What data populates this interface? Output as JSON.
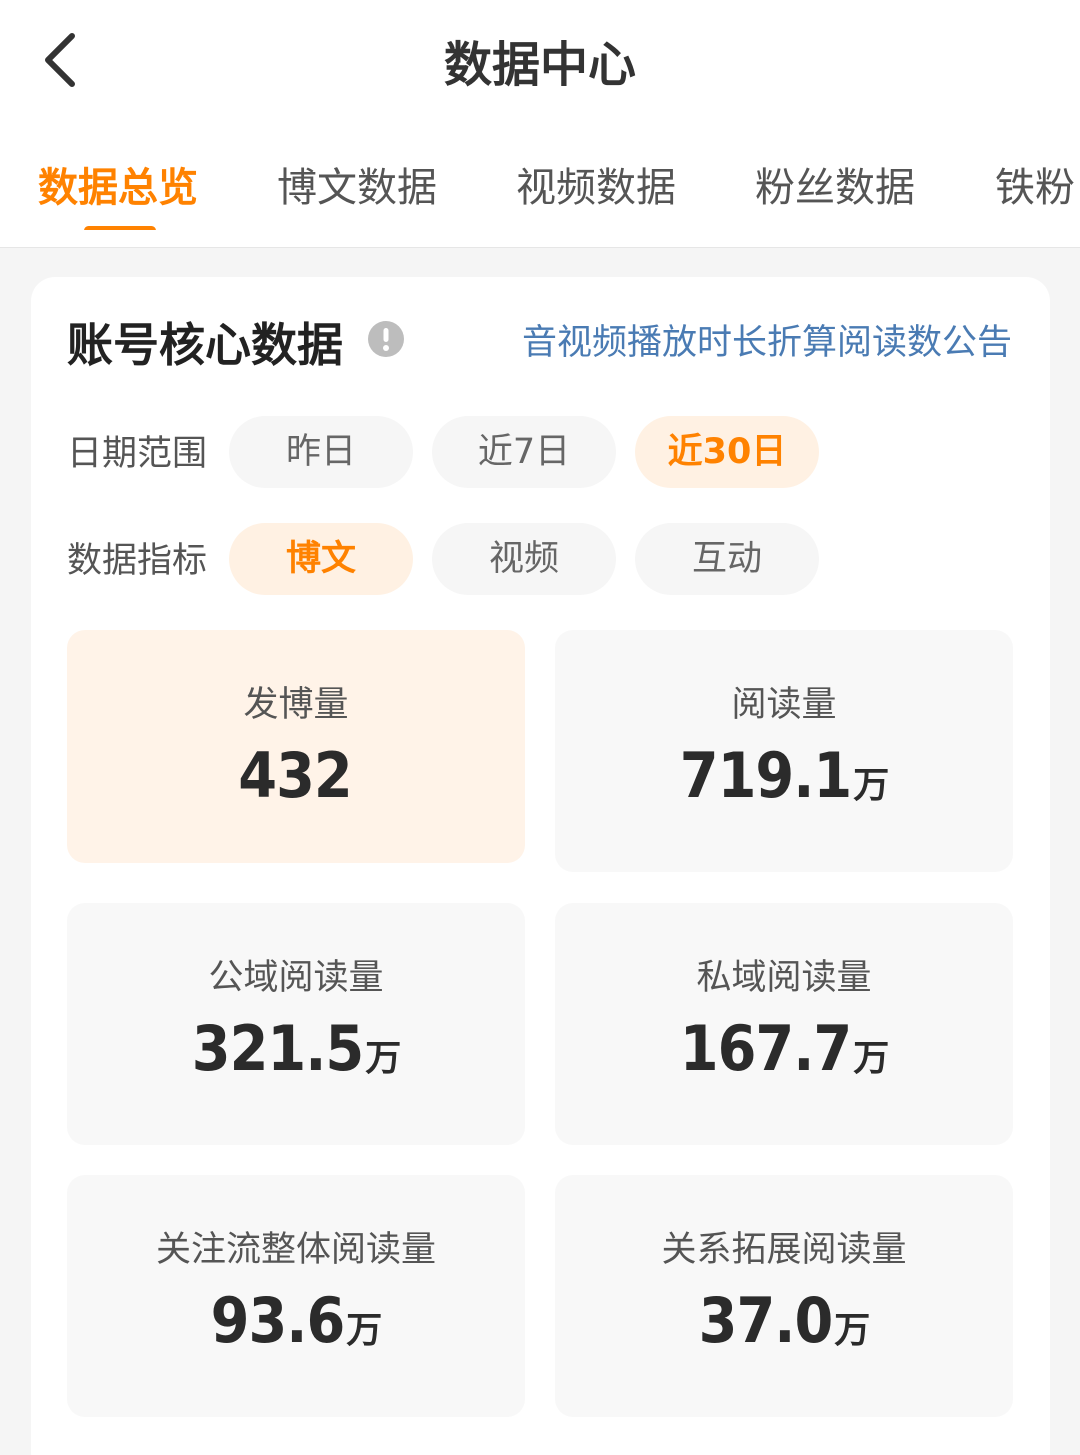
{
  "header": {
    "title": "数据中心",
    "back_icon": "chevron-left-icon"
  },
  "tabs": [
    {
      "label": "数据总览",
      "active": true
    },
    {
      "label": "博文数据",
      "active": false
    },
    {
      "label": "视频数据",
      "active": false
    },
    {
      "label": "粉丝数据",
      "active": false
    },
    {
      "label": "铁粉",
      "active": false
    }
  ],
  "core": {
    "title": "账号核心数据",
    "info_icon": "info-icon",
    "notice_link": "音视频播放时长折算阅读数公告",
    "date_range": {
      "label": "日期范围",
      "options": [
        "昨日",
        "近7日",
        "近30日"
      ],
      "selected": "近30日"
    },
    "metric_type": {
      "label": "数据指标",
      "options": [
        "博文",
        "视频",
        "互动"
      ],
      "selected": "博文"
    },
    "metrics": [
      {
        "label": "发博量",
        "value": "432",
        "unit": ""
      },
      {
        "label": "阅读量",
        "value": "719.1",
        "unit": "万"
      },
      {
        "label": "公域阅读量",
        "value": "321.5",
        "unit": "万"
      },
      {
        "label": "私域阅读量",
        "value": "167.7",
        "unit": "万"
      },
      {
        "label": "关注流整体阅读量",
        "value": "93.6",
        "unit": "万"
      },
      {
        "label": "关系拓展阅读量",
        "value": "37.0",
        "unit": "万"
      }
    ]
  },
  "colors": {
    "accent": "#ff8200",
    "link": "#4a7bb3",
    "active_bg": "#fff1e3"
  }
}
